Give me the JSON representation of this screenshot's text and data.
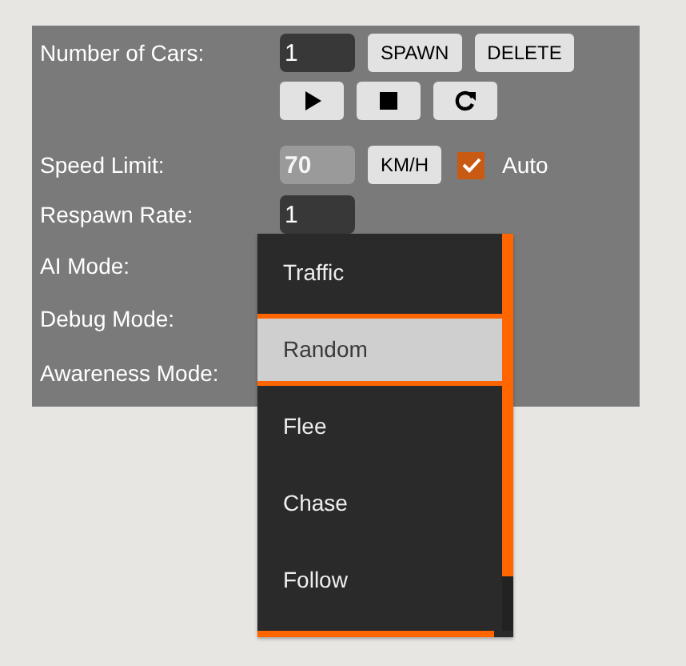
{
  "number_of_cars": {
    "label": "Number of Cars:",
    "value": "1",
    "buttons": [
      "SPAWN",
      "DELETE"
    ]
  },
  "playback_buttons": [
    {
      "kind": "play"
    },
    {
      "kind": "stop"
    },
    {
      "kind": "restart"
    }
  ],
  "speed_limit": {
    "label": "Speed Limit:",
    "value": "70",
    "disabled": true,
    "unit_button": "KM/H",
    "auto": {
      "label": "Auto",
      "checked": true
    }
  },
  "respawn_rate": {
    "label": "Respawn Rate:",
    "value": "1"
  },
  "modes": [
    {
      "label": "AI Mode:"
    },
    {
      "label": "Debug Mode:"
    },
    {
      "label": "Awareness Mode:"
    }
  ],
  "dropdown": {
    "options": [
      {
        "label": "Traffic",
        "selected": false
      },
      {
        "label": "Random",
        "selected": true
      },
      {
        "label": "Flee",
        "selected": false
      },
      {
        "label": "Chase",
        "selected": false
      },
      {
        "label": "Follow",
        "selected": false
      }
    ]
  }
}
